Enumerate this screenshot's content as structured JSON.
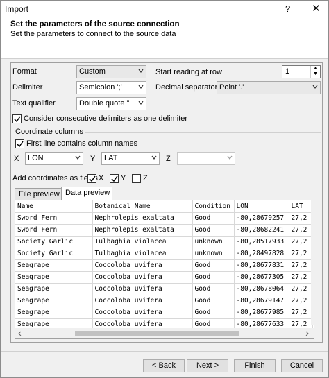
{
  "window": {
    "title": "Import",
    "help": "?",
    "close": "✕"
  },
  "header": {
    "title": "Set the parameters of the source connection",
    "subtitle": "Set the parameters to connect to the source data"
  },
  "form": {
    "format_label": "Format",
    "format_value": "Custom",
    "start_label": "Start reading at row",
    "start_value": "1",
    "delimiter_label": "Delimiter",
    "delimiter_value": "Semicolon ';'",
    "decimal_label": "Decimal separator",
    "decimal_value": "Point '.'",
    "qualifier_label": "Text qualifier",
    "qualifier_value": "Double quote \"",
    "consecutive_label": "Consider consecutive delimiters as one delimiter",
    "coord_label": "Coordinate columns",
    "firstline_label": "First line contains column names",
    "x_label": "X",
    "x_value": "LON",
    "y_label": "Y",
    "y_value": "LAT",
    "z_label": "Z",
    "z_value": "",
    "add_coords_label": "Add coordinates as fields",
    "add_x": "X",
    "add_y": "Y",
    "add_z": "Z"
  },
  "tabs": [
    "File preview",
    "Data preview"
  ],
  "table": {
    "columns": [
      "Name",
      "Botanical Name",
      "Condition",
      "LON",
      "LAT"
    ],
    "rows": [
      [
        "Sword Fern",
        "Nephrolepis exaltata",
        "Good",
        "-80,28679257",
        "27,2"
      ],
      [
        "Sword Fern",
        "Nephrolepis exaltata",
        "Good",
        "-80,28682241",
        "27,2"
      ],
      [
        "Society Garlic",
        "Tulbaghia violacea",
        "unknown",
        "-80,28517933",
        "27,2"
      ],
      [
        "Society Garlic",
        "Tulbaghia violacea",
        "unknown",
        "-80,28497828",
        "27,2"
      ],
      [
        "Seagrape",
        "Coccoloba uvifera",
        "Good",
        "-80,28677831",
        "27,2"
      ],
      [
        "Seagrape",
        "Coccoloba uvifera",
        "Good",
        "-80,28677305",
        "27,2"
      ],
      [
        "Seagrape",
        "Coccoloba uvifera",
        "Good",
        "-80,28678064",
        "27,2"
      ],
      [
        "Seagrape",
        "Coccoloba uvifera",
        "Good",
        "-80,28679147",
        "27,2"
      ],
      [
        "Seagrape",
        "Coccoloba uvifera",
        "Good",
        "-80,28677985",
        "27,2"
      ],
      [
        "Seagrape",
        "Coccoloba uvifera",
        "Good",
        "-80,28677633",
        "27,2"
      ]
    ]
  },
  "buttons": {
    "back": "< Back",
    "next": "Next >",
    "finish": "Finish",
    "cancel": "Cancel"
  }
}
